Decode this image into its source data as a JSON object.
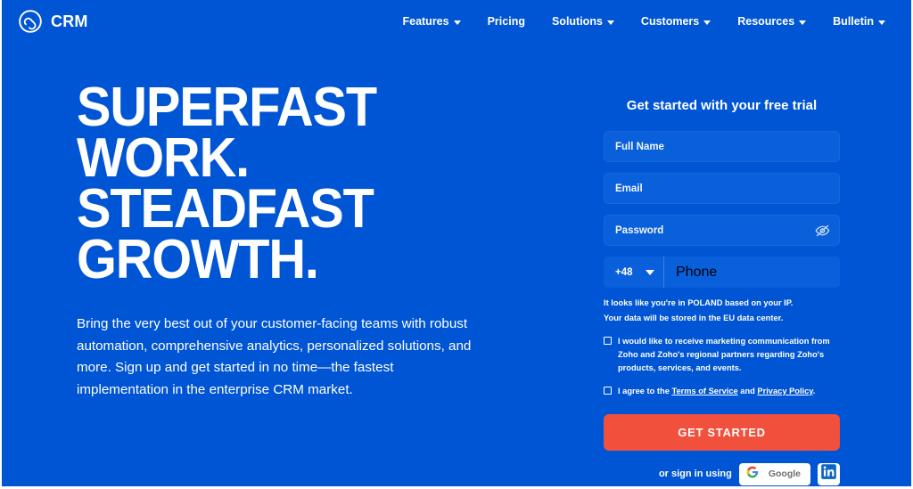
{
  "nav": {
    "brand": {
      "name": "CRM",
      "logo_icon": "infinity-circle-logo"
    },
    "links": [
      {
        "label": "Features",
        "has_caret": true
      },
      {
        "label": "Pricing",
        "has_caret": false
      },
      {
        "label": "Solutions",
        "has_caret": true
      },
      {
        "label": "Customers",
        "has_caret": true
      },
      {
        "label": "Resources",
        "has_caret": true
      },
      {
        "label": "Bulletin",
        "has_caret": true
      }
    ]
  },
  "hero": {
    "headline": "SUPERFAST\nWORK.\nSTEADFAST\nGROWTH.",
    "subcopy": "Bring the very best out of your customer-facing teams with robust automation, comprehensive analytics, personalized solutions, and more. Sign up and get started in no time—the fastest implementation in the enterprise CRM market."
  },
  "form": {
    "title": "Get started with your free trial",
    "fields": {
      "full_name": {
        "placeholder": "Full Name",
        "value": ""
      },
      "email": {
        "placeholder": "Email",
        "value": ""
      },
      "password": {
        "placeholder": "Password",
        "value": "",
        "toggle_icon": "eye-off-icon"
      },
      "country_code": {
        "value": "+48"
      },
      "phone": {
        "placeholder": "Phone",
        "value": ""
      }
    },
    "ip_note_line1_pre": "It looks like you're in ",
    "ip_note_country": "POLAND",
    "ip_note_line1_post": " based on your IP.",
    "ip_note_line2": "Your data will be stored in the EU data center.",
    "consent_marketing": "I would like to receive marketing communication from Zoho and Zoho's regional partners regarding Zoho's products, services, and events.",
    "consent_terms_pre": "I agree to the ",
    "consent_terms_link": "Terms of Service",
    "consent_terms_mid": " and ",
    "consent_privacy_link": "Privacy Policy",
    "consent_terms_post": ".",
    "cta_label": "GET STARTED",
    "social_label": "or sign in using",
    "google_label": "Google",
    "linkedin_label": "in"
  },
  "colors": {
    "background": "#0055d4",
    "field": "#0a5fdb",
    "cta": "#f0503c",
    "text": "#ffffff"
  }
}
